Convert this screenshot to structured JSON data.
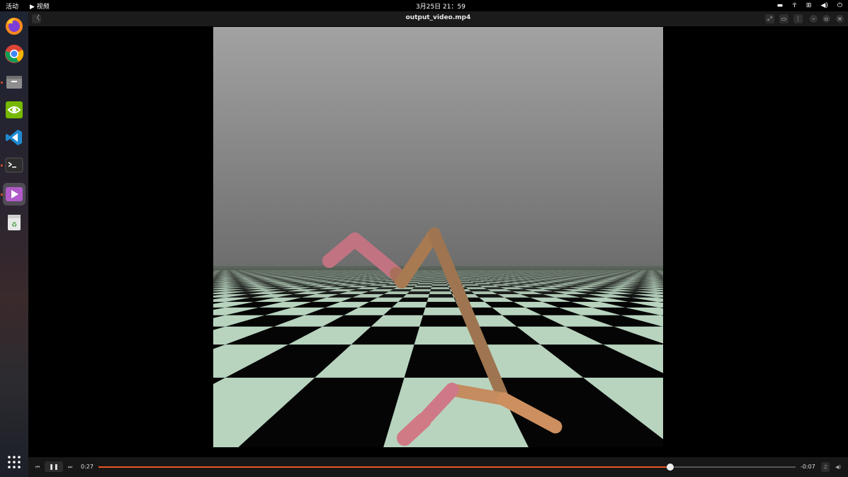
{
  "topbar": {
    "activities": "活动",
    "app_menu": "▶ 视频",
    "clock": "3月25日  21：59",
    "tray_icons": [
      "keyboard-icon",
      "accessibility-icon",
      "network-icon",
      "volume-icon",
      "power-icon"
    ]
  },
  "dock": {
    "items": [
      "firefox",
      "chrome",
      "files",
      "nvidia-settings",
      "vscode",
      "terminal",
      "videos",
      "trash"
    ],
    "apps_grid_icon": "show-apps-icon"
  },
  "header": {
    "back_glyph": "〈",
    "title": "output_video.mp4",
    "actions": [
      "fullscreen-icon",
      "screenshot-icon",
      "menu-icon"
    ],
    "window_buttons": [
      "minimize",
      "maximize",
      "close"
    ]
  },
  "player": {
    "elapsed": "0:27",
    "remaining": "-0:07",
    "progress": 0.82,
    "state": "playing"
  },
  "colors": {
    "accent": "#e95420",
    "floor_light": "#b8d4bf",
    "robot_thigh": "#c88a5c",
    "robot_foot": "#cc7a86"
  }
}
